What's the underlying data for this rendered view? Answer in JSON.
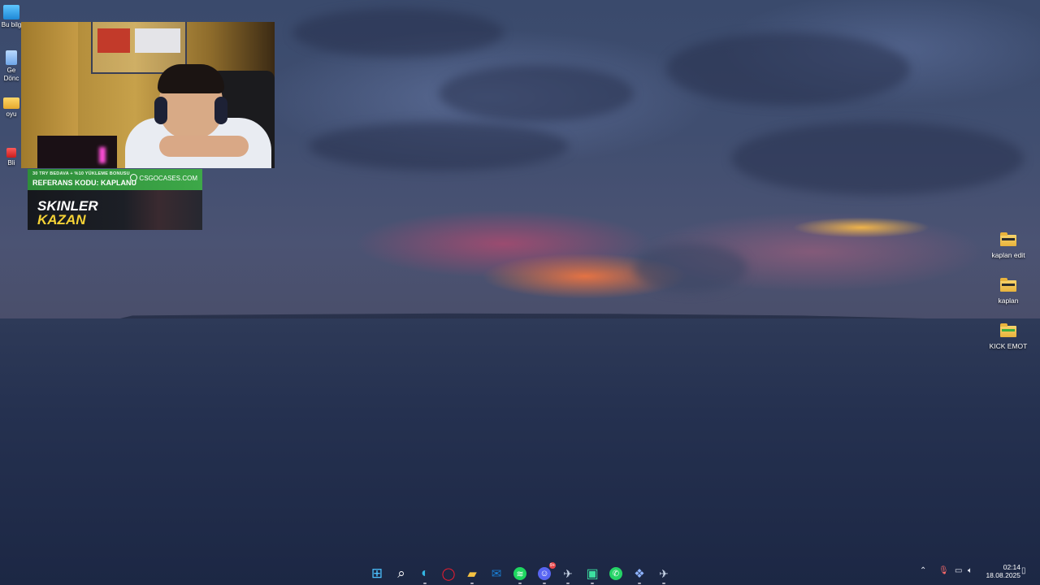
{
  "desktop_left": {
    "icons": [
      {
        "label": "Bu bilg",
        "icon": "this-pc-icon"
      },
      {
        "label": "Ge\nDönc",
        "icon": "recycle-bin-icon"
      },
      {
        "label": "oyu",
        "icon": "folder-icon"
      },
      {
        "label": "Bli",
        "icon": "shortcut-icon"
      }
    ]
  },
  "banner": {
    "line1": "30 TRY BEDAVA + %10 YÜKLEME BONUSU",
    "line2": "REFERANS KODU: KAPLANU",
    "logo_text": "CSGOCASES.COM",
    "big_line1": "SKINLER",
    "big_line2": "KAZAN"
  },
  "desktop_right": {
    "icons": [
      {
        "label": "kaplan edit",
        "icon": "folder-icon"
      },
      {
        "label": "kaplan",
        "icon": "folder-icon"
      },
      {
        "label": "KICK EMOT",
        "icon": "folder-icon"
      }
    ]
  },
  "taskbar": {
    "apps": [
      {
        "name": "start",
        "icon": "windows-start-icon",
        "glyph": "⊞",
        "color": "#4cc2ff"
      },
      {
        "name": "search",
        "icon": "search-icon",
        "glyph": "⌕",
        "color": "#ffffff"
      },
      {
        "name": "edge",
        "icon": "edge-icon",
        "glyph": "◐",
        "color": "#34b7e4"
      },
      {
        "name": "opera",
        "icon": "opera-icon",
        "glyph": "◯",
        "color": "#ff1b2d"
      },
      {
        "name": "file-explorer",
        "icon": "folder-icon",
        "glyph": "▰",
        "color": "#f5c242"
      },
      {
        "name": "outlook",
        "icon": "outlook-icon",
        "glyph": "✉",
        "color": "#1a7fd4"
      },
      {
        "name": "spotify",
        "icon": "spotify-icon",
        "glyph": "≋",
        "color": "#1ed760"
      },
      {
        "name": "discord",
        "icon": "discord-icon",
        "glyph": "☺",
        "color": "#7f86ff"
      },
      {
        "name": "steam",
        "icon": "steam-icon",
        "glyph": "✈",
        "color": "#c9d6e8"
      },
      {
        "name": "app-green",
        "icon": "app-icon",
        "glyph": "▣",
        "color": "#3ce0a0"
      },
      {
        "name": "whatsapp",
        "icon": "whatsapp-icon",
        "glyph": "✆",
        "color": "#25d366"
      },
      {
        "name": "app-blue",
        "icon": "app-icon",
        "glyph": "❖",
        "color": "#8fb4ff"
      },
      {
        "name": "steam-2",
        "icon": "steam-icon",
        "glyph": "✈",
        "color": "#c9d6e8"
      }
    ],
    "discord_badge": "9+",
    "clock_time": "02:14",
    "clock_date": "18.08.2025"
  }
}
